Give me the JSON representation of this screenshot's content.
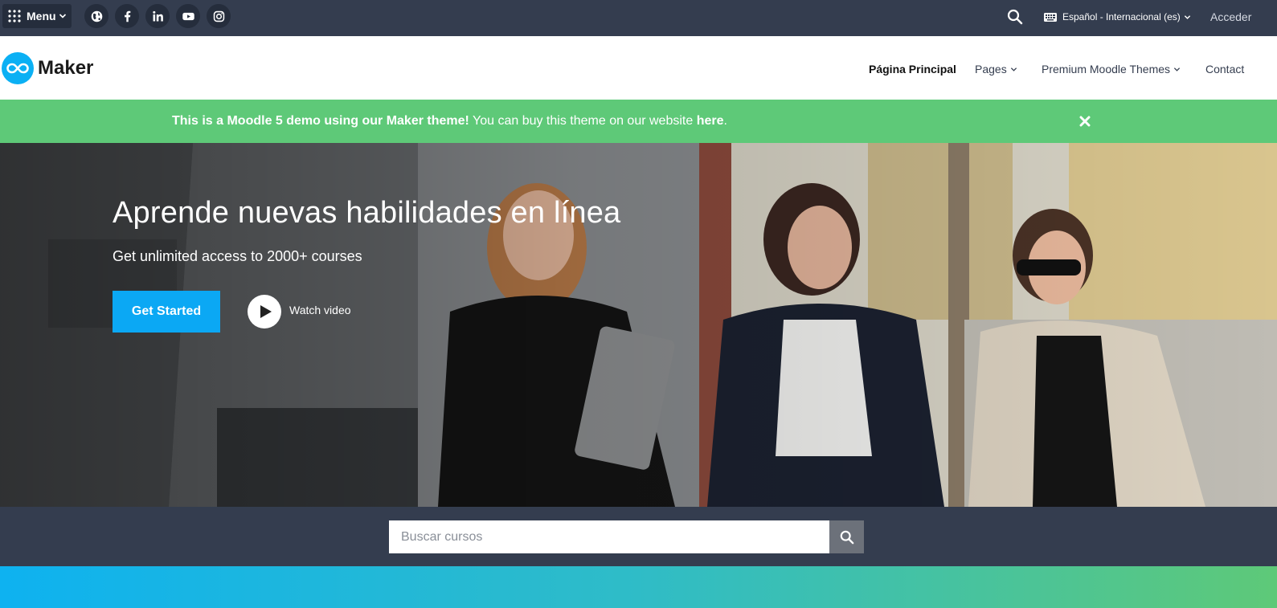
{
  "topbar": {
    "menu_label": "Menu",
    "social_icons": [
      "globe-icon",
      "facebook-icon",
      "linkedin-icon",
      "youtube-icon",
      "instagram-icon"
    ],
    "language": "Español - Internacional (es)",
    "login": "Acceder"
  },
  "navbar": {
    "brand": "Maker",
    "items": [
      {
        "label": "Página Principal",
        "active": true,
        "dropdown": false
      },
      {
        "label": "Pages",
        "active": false,
        "dropdown": true
      },
      {
        "label": "Premium Moodle Themes",
        "active": false,
        "dropdown": true
      },
      {
        "label": "Contact",
        "active": false,
        "dropdown": false
      }
    ]
  },
  "alert": {
    "bold_text": "This is a Moodle 5 demo using our Maker theme!",
    "text": " You can buy this theme on our website ",
    "link_text": "here",
    "end": "."
  },
  "hero": {
    "title": "Aprende nuevas habilidades en línea",
    "subtitle": "Get unlimited access to 2000+ courses",
    "cta_label": "Get Started",
    "video_label": "Watch video"
  },
  "search": {
    "placeholder": "Buscar cursos"
  },
  "colors": {
    "topbar": "#343d4f",
    "accent_blue": "#0ba8f4",
    "alert_green": "#5ec978"
  }
}
